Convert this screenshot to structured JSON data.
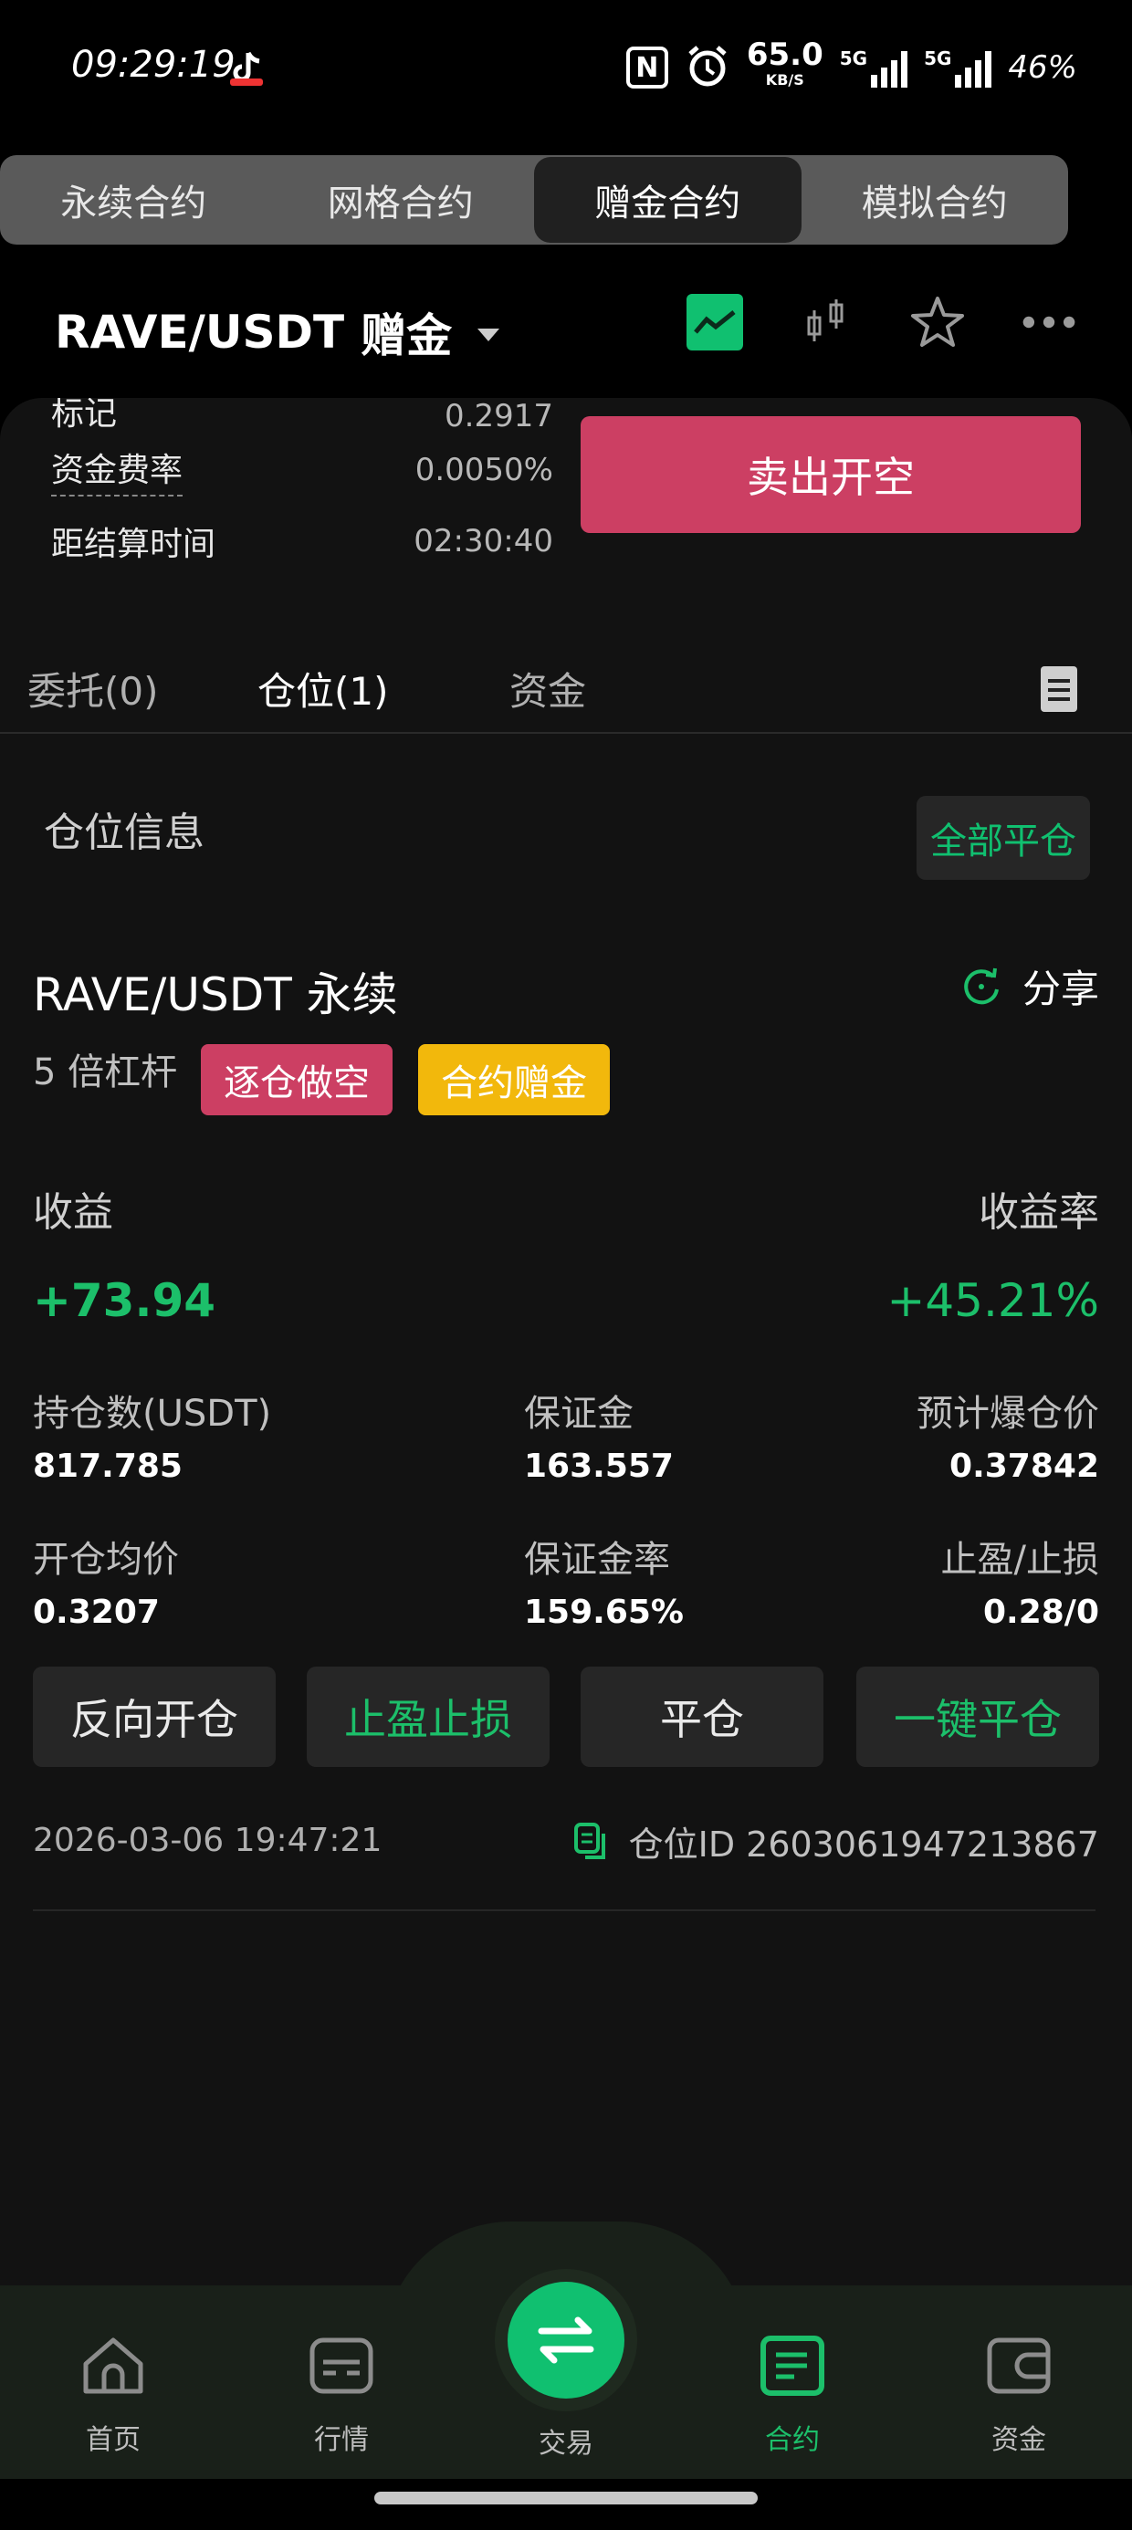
{
  "status_bar": {
    "time": "09:29:19",
    "net_speed": "65.0",
    "net_unit": "KB/S",
    "sig1_label": "5G",
    "sig2_label": "5G",
    "battery": "46%",
    "icons": [
      "tiktok-icon",
      "nfc-icon",
      "alarm-icon",
      "signal-icon",
      "signal-icon"
    ]
  },
  "top_tabs": [
    {
      "label": "永续合约",
      "active": false
    },
    {
      "label": "网格合约",
      "active": false
    },
    {
      "label": "赠金合约",
      "active": true
    },
    {
      "label": "模拟合约",
      "active": false
    }
  ],
  "pair": {
    "symbol": "RAVE/USDT",
    "tag": "赠金"
  },
  "info": {
    "mark_label": "标记",
    "mark_value": "0.2917",
    "funding_label": "资金费率",
    "funding_value": "0.0050%",
    "settle_label": "距结算时间",
    "settle_value": "02:30:40"
  },
  "sell_button": "卖出开空",
  "sub_tabs": {
    "orders": "委托(0)",
    "positions": "仓位(1)",
    "funds": "资金"
  },
  "section": {
    "title": "仓位信息",
    "close_all": "全部平仓"
  },
  "position": {
    "title": "RAVE/USDT 永续",
    "share": "分享",
    "leverage": "5 倍杠杆",
    "tag_mode": "逐仓做空",
    "tag_bonus": "合约赠金",
    "pnl_label": "收益",
    "pnl_value": "+73.94",
    "roi_label": "收益率",
    "roi_value": "+45.21%",
    "size_label": "持仓数(USDT)",
    "size_value": "817.785",
    "margin_label": "保证金",
    "margin_value": "163.557",
    "liq_label": "预计爆仓价",
    "liq_value": "0.37842",
    "entry_label": "开仓均价",
    "entry_value": "0.3207",
    "margin_rate_label": "保证金率",
    "margin_rate_value": "159.65%",
    "tpsl_label": "止盈/止损",
    "tpsl_value": "0.28/0",
    "actions": {
      "reverse": "反向开仓",
      "tpsl": "止盈止损",
      "close": "平仓",
      "quick_close": "一键平仓"
    },
    "timestamp": "2026-03-06 19:47:21",
    "position_id": "仓位ID 2603061947213867"
  },
  "bottom_nav": {
    "home": "首页",
    "market": "行情",
    "trade": "交易",
    "futures": "合约",
    "assets": "资金"
  },
  "colors": {
    "green": "#1cbf6a",
    "red": "#cc3f63",
    "yellow": "#f2b80c",
    "panel": "#121212"
  }
}
